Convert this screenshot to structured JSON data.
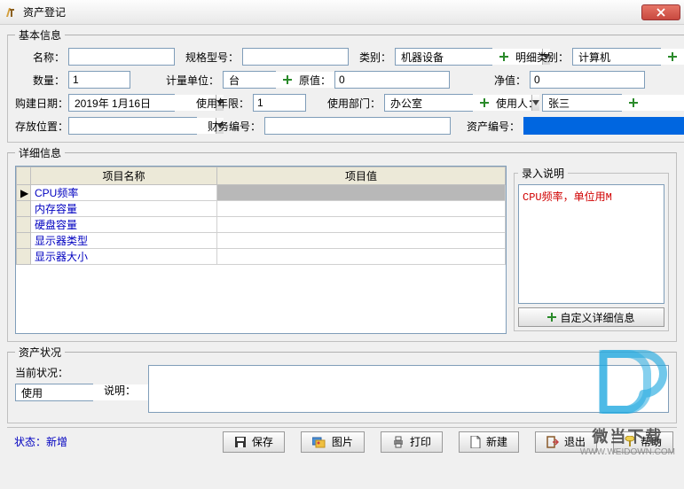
{
  "window": {
    "title": "资产登记"
  },
  "basic": {
    "legend": "基本信息",
    "name_label": "名称：",
    "name_value": "",
    "spec_label": "规格型号：",
    "spec_value": "",
    "category_label": "类别：",
    "category_value": "机器设备",
    "subcat_label": "明细类别：",
    "subcat_value": "计算机",
    "qty_label": "数量：",
    "qty_value": "1",
    "unit_label": "计量单位：",
    "unit_value": "台",
    "orig_label": "原值：",
    "orig_value": "0",
    "net_label": "净值：",
    "net_value": "0",
    "buydate_label": "购建日期：",
    "buydate_value": "2019年 1月16日",
    "years_label": "使用年限：",
    "years_value": "1",
    "dept_label": "使用部门：",
    "dept_value": "办公室",
    "user_label": "使用人：",
    "user_value": "张三",
    "loc_label": "存放位置：",
    "loc_value": "",
    "finno_label": "财务编号：",
    "finno_value": "",
    "assetno_label": "资产编号："
  },
  "detail": {
    "legend": "详细信息",
    "col_name": "项目名称",
    "col_value": "项目值",
    "rows": [
      {
        "name": "CPU频率",
        "value": ""
      },
      {
        "name": "内存容量",
        "value": ""
      },
      {
        "name": "硬盘容量",
        "value": ""
      },
      {
        "name": "显示器类型",
        "value": ""
      },
      {
        "name": "显示器大小",
        "value": ""
      }
    ],
    "instr_legend": "录入说明",
    "instr_text": "CPU频率，单位用M",
    "custom_btn": "自定义详细信息"
  },
  "status": {
    "legend": "资产状况",
    "cur_label": "当前状况：",
    "cur_value": "使用",
    "desc_label": "说明：",
    "desc_value": ""
  },
  "footer": {
    "state_label": "状态：",
    "state_value": "新增",
    "save": "保存",
    "image": "图片",
    "print": "打印",
    "new": "新建",
    "exit": "退出",
    "help": "帮助"
  },
  "watermark": {
    "brand": "微当下载",
    "url": "WWW.WEIDOWN.COM"
  }
}
